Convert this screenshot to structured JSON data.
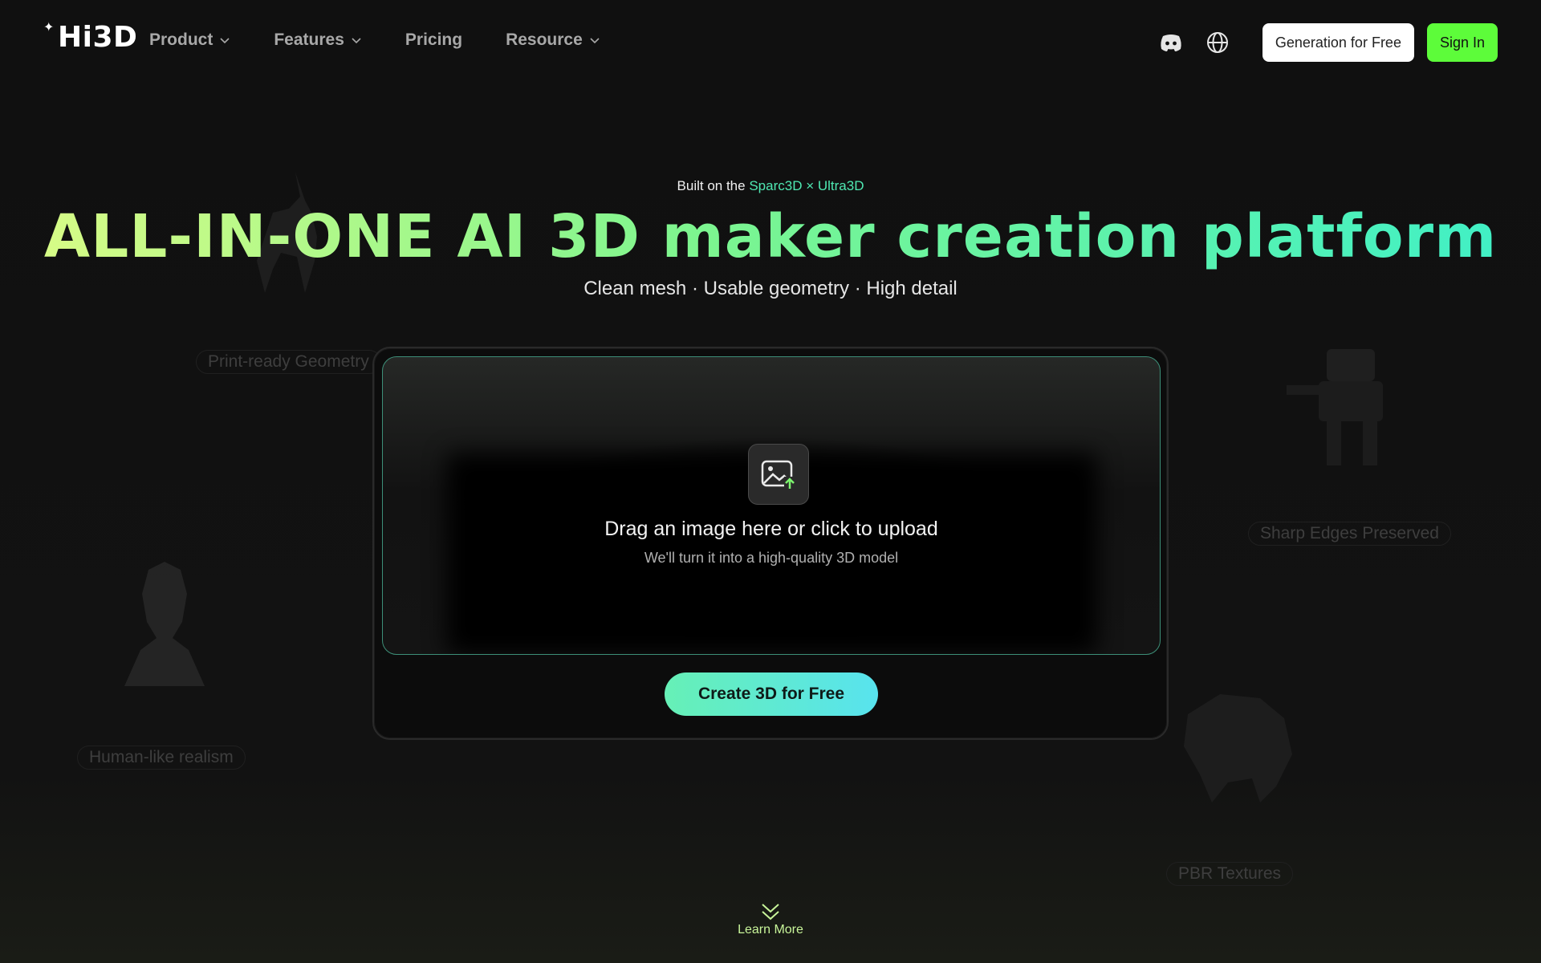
{
  "header": {
    "logo": "Hi3D",
    "nav": [
      {
        "label": "Product",
        "dropdown": true
      },
      {
        "label": "Features",
        "dropdown": true
      },
      {
        "label": "Pricing",
        "dropdown": false
      },
      {
        "label": "Resource",
        "dropdown": true
      }
    ],
    "icons": [
      "discord-icon",
      "globe-icon"
    ],
    "generate_label": "Generation for Free",
    "signin_label": "Sign In"
  },
  "hero": {
    "built_on_prefix": "Built on the",
    "built_on_highlight": "Sparc3D × Ultra3D",
    "headline": "ALL-IN-ONE AI 3D maker creation platform",
    "subline": "Clean mesh · Usable geometry · High detail"
  },
  "background_tags": {
    "print_ready": "Print-ready Geometry",
    "human_like": "Human-like realism",
    "sharp_edges": "Sharp Edges Preserved",
    "pbr": "PBR Textures"
  },
  "upload": {
    "title": "Drag an image here or click to upload",
    "subtitle": "We'll turn it into a high-quality 3D model",
    "cta": "Create 3D for Free"
  },
  "learn_more": "Learn More",
  "colors": {
    "accent_green": "#5dfc3a",
    "headline_start": "#dcfc86",
    "headline_end": "#3ef0c8",
    "highlight_text": "#4fe8b2",
    "cta_start": "#66f0b6",
    "cta_end": "#58e3ee"
  }
}
